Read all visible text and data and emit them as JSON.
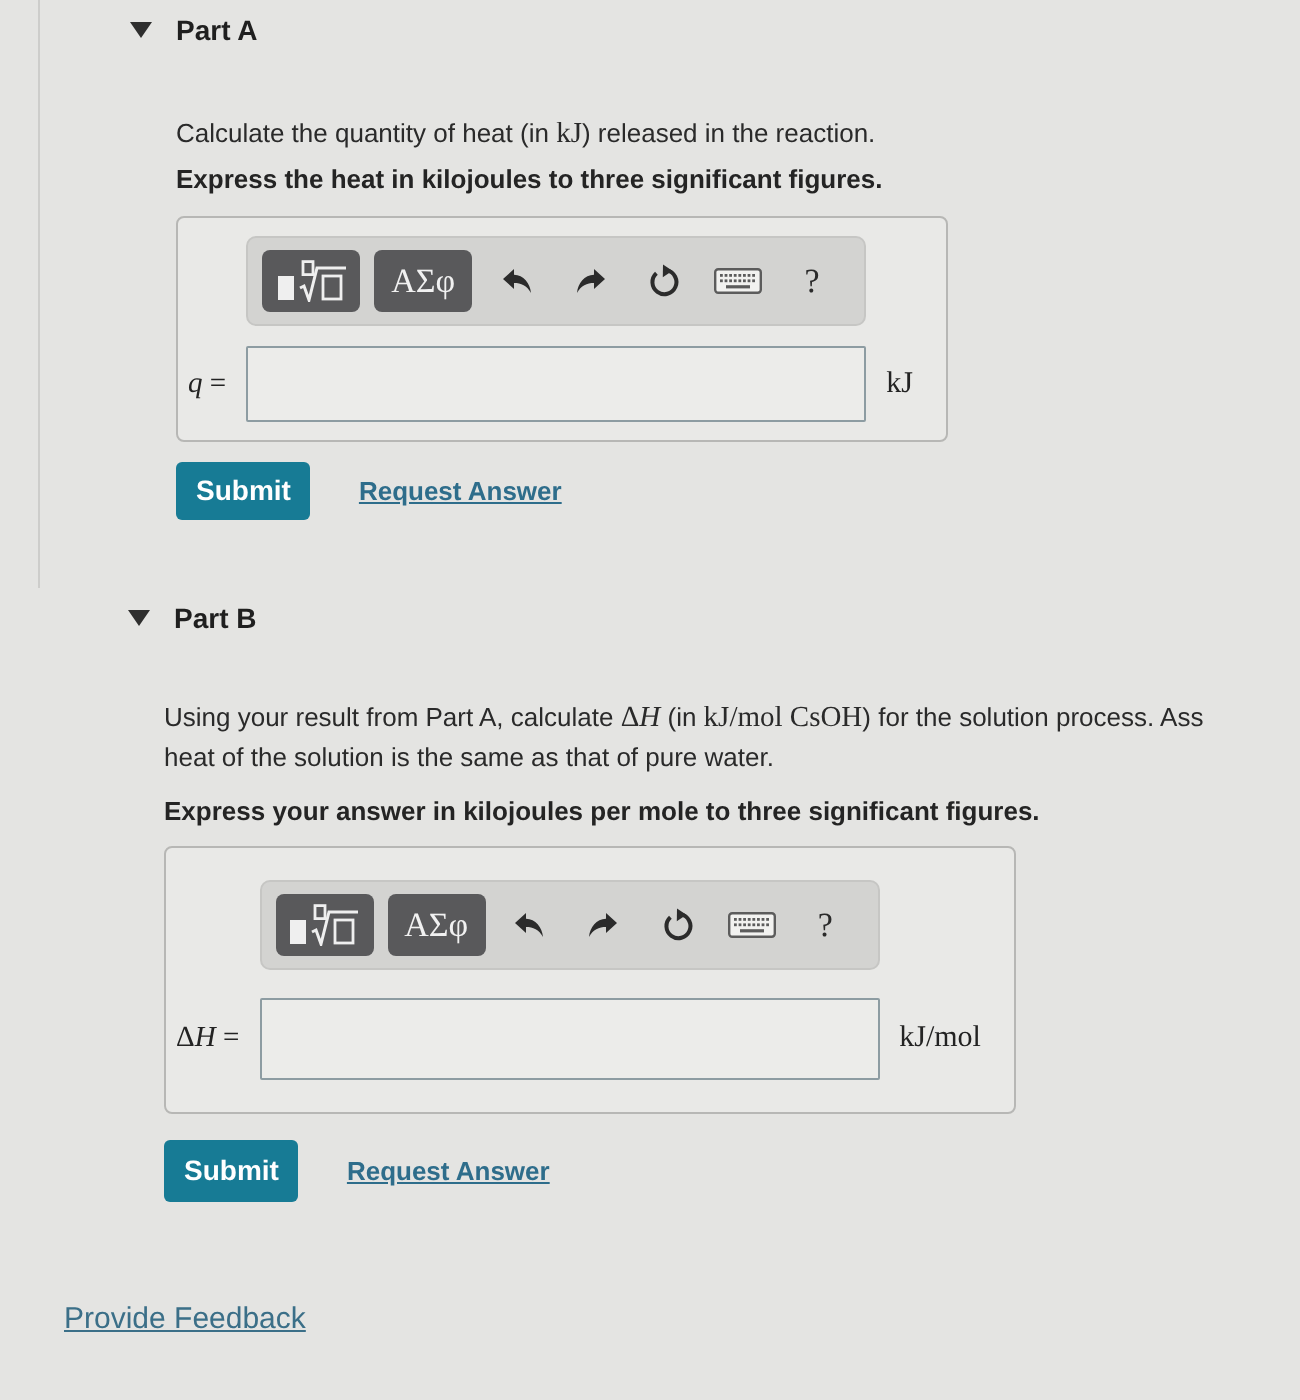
{
  "parts": [
    {
      "title": "Part A",
      "expanded": true,
      "question": [
        [
          {
            "kind": "text",
            "text": "Calculate the quantity of heat (in "
          },
          {
            "kind": "math",
            "text": "kJ"
          },
          {
            "kind": "text",
            "text": ") released in the reaction."
          }
        ]
      ],
      "instruction": "Express the heat in kilojoules to three significant figures.",
      "answer": {
        "toolbar": [
          {
            "kind": "template"
          },
          {
            "kind": "symbols",
            "label": "ΑΣφ"
          },
          {
            "kind": "undo"
          },
          {
            "kind": "redo"
          },
          {
            "kind": "reset"
          },
          {
            "kind": "keyboard"
          },
          {
            "kind": "help",
            "label": "?"
          }
        ],
        "variable": [
          {
            "kind": "math_var",
            "text": "q"
          },
          {
            "kind": "math",
            "text": " ="
          }
        ],
        "unit": "kJ"
      },
      "actions": {
        "submit": "Submit",
        "request_answer": "Request Answer"
      }
    },
    {
      "title": "Part B",
      "expanded": true,
      "question": [
        [
          {
            "kind": "text",
            "text": "Using your result from Part A, calculate "
          },
          {
            "kind": "math",
            "text": "Δ"
          },
          {
            "kind": "math_var",
            "text": "H"
          },
          {
            "kind": "text",
            "text": " (in "
          },
          {
            "kind": "math",
            "text": "kJ/mol CsOH"
          },
          {
            "kind": "text",
            "text": ") for the solution process. Ass"
          }
        ],
        [
          {
            "kind": "text",
            "text": "heat of the solution is the same as that of pure water."
          }
        ]
      ],
      "instruction": "Express your answer in kilojoules per mole to three significant figures.",
      "answer": {
        "toolbar": [
          {
            "kind": "template"
          },
          {
            "kind": "symbols",
            "label": "ΑΣφ"
          },
          {
            "kind": "undo"
          },
          {
            "kind": "redo"
          },
          {
            "kind": "reset"
          },
          {
            "kind": "keyboard"
          },
          {
            "kind": "help",
            "label": "?"
          }
        ],
        "variable": [
          {
            "kind": "math",
            "text": "Δ"
          },
          {
            "kind": "math_var",
            "text": "H"
          },
          {
            "kind": "math",
            "text": " ="
          }
        ],
        "unit": "kJ/mol"
      },
      "actions": {
        "submit": "Submit",
        "request_answer": "Request Answer"
      }
    }
  ],
  "feedback_link": "Provide Feedback"
}
